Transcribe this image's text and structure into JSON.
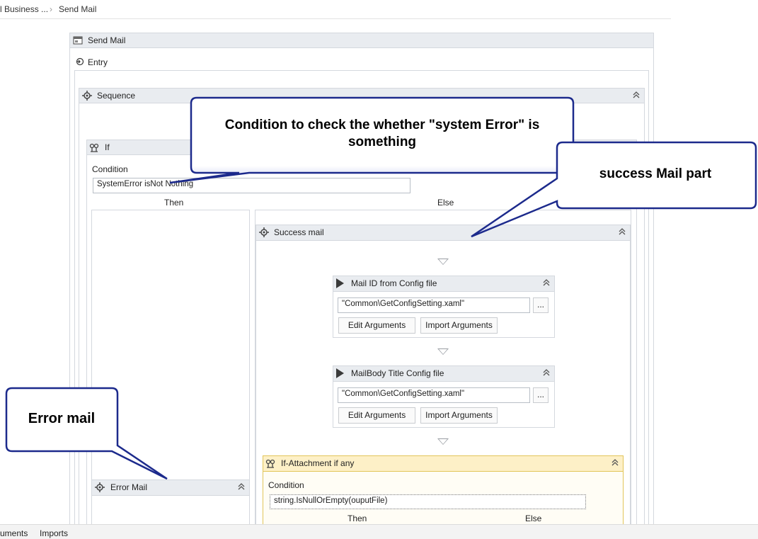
{
  "breadcrumb": {
    "parent": "l Business ...",
    "current": "Send Mail"
  },
  "send_mail": {
    "title": "Send Mail",
    "entry": "Entry"
  },
  "sequence": {
    "title": "Sequence"
  },
  "if_block": {
    "title": "If",
    "condition_label": "Condition",
    "condition_value": "SystemError isNot Nothing",
    "then_label": "Then",
    "else_label": "Else"
  },
  "success_mail": {
    "title": "Success mail"
  },
  "mail_id": {
    "title": "Mail ID from Config file",
    "file": "\"Common\\GetConfigSetting.xaml\"",
    "browse": "...",
    "edit_args": "Edit Arguments",
    "import_args": "Import Arguments"
  },
  "mail_body": {
    "title": "MailBody Title Config file",
    "file": "\"Common\\GetConfigSetting.xaml\"",
    "browse": "...",
    "edit_args": "Edit Arguments",
    "import_args": "Import Arguments"
  },
  "if_attachment": {
    "title": "If-Attachment if any",
    "condition_label": "Condition",
    "condition_value": "string.IsNullOrEmpty(ouputFile)",
    "then_label": "Then",
    "else_label": "Else"
  },
  "error_mail": {
    "title": "Error Mail"
  },
  "callouts": {
    "condition": "Condition to check the whether \"system Error\" is something",
    "success": "success Mail part",
    "error": "Error mail"
  },
  "bottom_tabs": {
    "arguments": "uments",
    "imports": "Imports"
  },
  "colors": {
    "header_bg": "#e9ecf0",
    "attachment_bg": "#fdf0c7",
    "callout_fill": "#ffffff",
    "callout_border": "#1c2a8c"
  },
  "icons": [
    "chevron-right-icon",
    "sequence-icon",
    "entry-icon",
    "collapse-icon",
    "if-icon",
    "play-icon",
    "arrow-down-icon"
  ]
}
